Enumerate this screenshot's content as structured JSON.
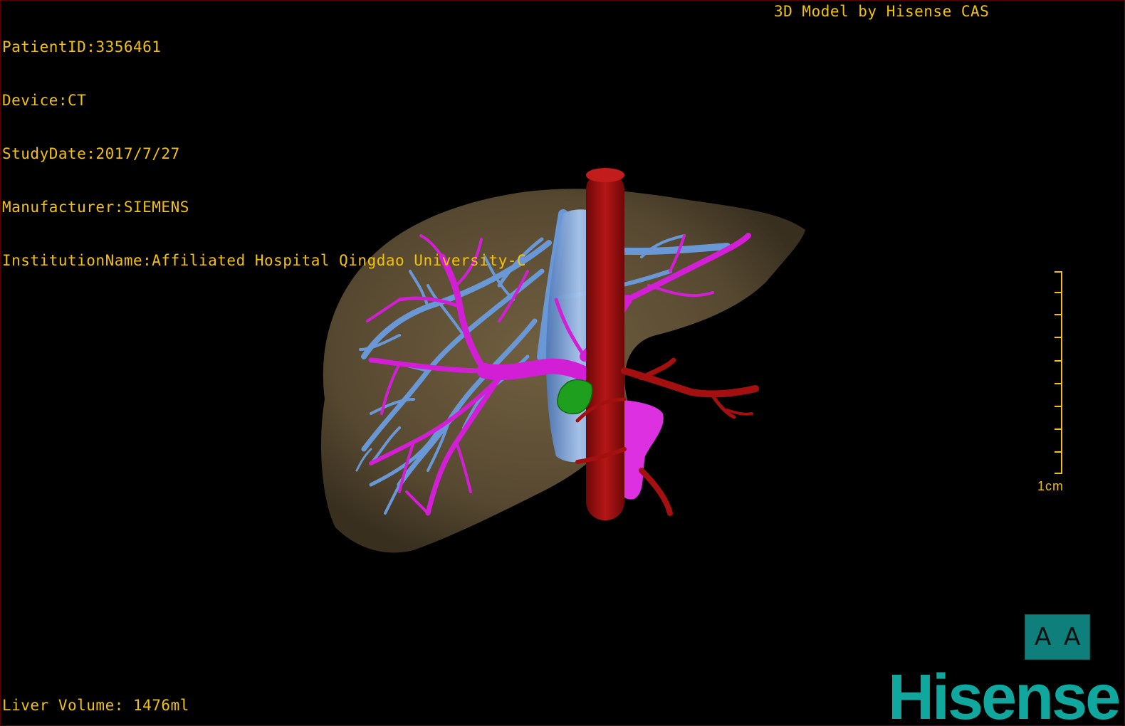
{
  "dicom_info": {
    "patient_id": "PatientID:3356461",
    "device": "Device:CT",
    "study_date": "StudyDate:2017/7/27",
    "manufacturer": "Manufacturer:SIEMENS",
    "institution": "InstitutionName:Affiliated Hospital Qingdao University-C"
  },
  "model_credit": "3D Model by Hisense CAS",
  "liver_volume": "Liver Volume: 1476ml",
  "scale_bar": {
    "label": "1cm"
  },
  "orientation": {
    "left_glyph": "A",
    "right_glyph": "A"
  },
  "brand": "Hisense",
  "colors": {
    "overlay_text": "#f2c20a",
    "liver": "#6b5a3e",
    "hepatic_vein": "#6a98d6",
    "portal_vein": "#d21fd6",
    "aorta": "#a3100f",
    "lesion": "#1ea01e",
    "brand": "#10a79e"
  }
}
